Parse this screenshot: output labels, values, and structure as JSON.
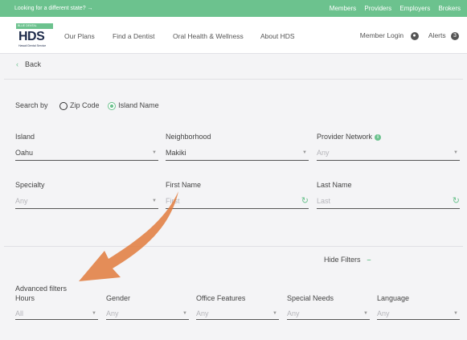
{
  "topbar": {
    "state_link": "Looking for a different state? →",
    "links": [
      "Members",
      "Providers",
      "Employers",
      "Brokers"
    ]
  },
  "logo": {
    "band_text": "BLUE DENTAL",
    "word": "HDS",
    "sub": "Hawaii Dental Service"
  },
  "nav": {
    "items": [
      "Our Plans",
      "Find a Dentist",
      "Oral Health & Wellness",
      "About HDS"
    ],
    "member_login": "Member Login",
    "alerts": "Alerts",
    "alerts_count": "3"
  },
  "back": "Back",
  "search": {
    "label": "Search by",
    "options": [
      "Zip Code",
      "Island Name"
    ],
    "selected": "Island Name"
  },
  "fields": {
    "island": {
      "label": "Island",
      "value": "Oahu"
    },
    "neighborhood": {
      "label": "Neighborhood",
      "value": "Makiki"
    },
    "provider_network": {
      "label": "Provider Network",
      "placeholder": "Any"
    },
    "specialty": {
      "label": "Specialty",
      "placeholder": "Any"
    },
    "first_name": {
      "label": "First Name",
      "placeholder": "First"
    },
    "last_name": {
      "label": "Last Name",
      "placeholder": "Last"
    }
  },
  "hide_filters": "Hide Filters",
  "advanced": {
    "title": "Advanced filters",
    "filters": [
      {
        "label": "Hours",
        "placeholder": "All"
      },
      {
        "label": "Gender",
        "placeholder": "Any"
      },
      {
        "label": "Office Features",
        "placeholder": "Any"
      },
      {
        "label": "Special Needs",
        "placeholder": "Any"
      },
      {
        "label": "Language",
        "placeholder": "Any"
      }
    ]
  },
  "colors": {
    "brand_green": "#6cc28e",
    "annotation_arrow": "#e07a3c",
    "navy": "#1d2a4a"
  }
}
